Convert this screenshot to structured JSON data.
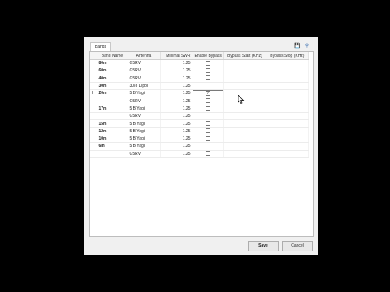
{
  "tab": {
    "label": "Bands"
  },
  "toolbar": {
    "save_icon": "floppy-disk-icon",
    "search_icon": "search-icon"
  },
  "table": {
    "headers": [
      "Band Name",
      "Antenna",
      "Minimal SWR",
      "Enable Bypass",
      "Bypass Start (KHz)",
      "Bypass Stop (KHz)"
    ],
    "rows": [
      {
        "band": "80m",
        "antenna": "G5RV",
        "swr": "1.25",
        "bypass": false
      },
      {
        "band": "60m",
        "antenna": "G5RV",
        "swr": "1.25",
        "bypass": false
      },
      {
        "band": "40m",
        "antenna": "G5RV",
        "swr": "1.25",
        "bypass": false
      },
      {
        "band": "30m",
        "antenna": "30/8 Dipol",
        "swr": "1.25",
        "bypass": false
      },
      {
        "band": "20m",
        "antenna": "5 B Yagi",
        "swr": "1.25",
        "bypass": true
      },
      {
        "band": "",
        "antenna": "G5RV",
        "swr": "1.25",
        "bypass": false
      },
      {
        "band": "17m",
        "antenna": "5 B Yagi",
        "swr": "1.25",
        "bypass": false
      },
      {
        "band": "",
        "antenna": "G5RV",
        "swr": "1.25",
        "bypass": false
      },
      {
        "band": "15m",
        "antenna": "5 B Yagi",
        "swr": "1.25",
        "bypass": false
      },
      {
        "band": "12m",
        "antenna": "5 B Yagi",
        "swr": "1.25",
        "bypass": false
      },
      {
        "band": "10m",
        "antenna": "5 B Yagi",
        "swr": "1.25",
        "bypass": false
      },
      {
        "band": "6m",
        "antenna": "5 B Yagi",
        "swr": "1.25",
        "bypass": false
      },
      {
        "band": "",
        "antenna": "G5RV",
        "swr": "1.25",
        "bypass": false
      }
    ]
  },
  "buttons": {
    "save": "Save",
    "cancel": "Cancel"
  },
  "colors": {
    "background": "#000000",
    "dialog": "#f0f0f0",
    "panel": "#ffffff"
  }
}
